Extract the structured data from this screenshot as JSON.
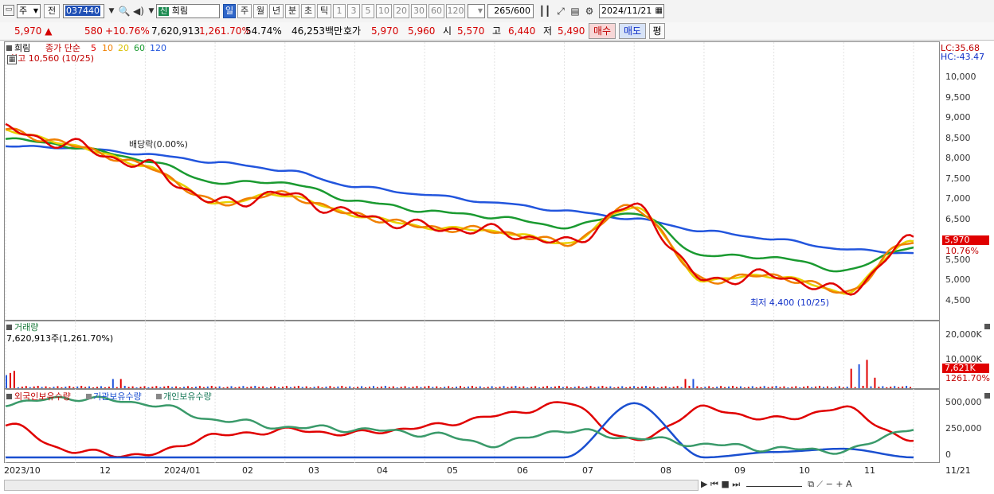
{
  "toolbar": {
    "market_type": "주",
    "prev_label": "전",
    "code": "037440",
    "badge": "신",
    "name": "희림",
    "periods": [
      "일",
      "주",
      "월",
      "년",
      "분",
      "초",
      "틱"
    ],
    "active_period": "일",
    "intervals": [
      "1",
      "3",
      "5",
      "10",
      "20",
      "30",
      "60",
      "120"
    ],
    "count": "265",
    "count_total": "/600",
    "date": "2024/11/21"
  },
  "quote": {
    "price": "5,970",
    "arrow": "▲",
    "change": "580",
    "change_pct": "+10.76%",
    "volume": "7,620,913",
    "volume_pct": "1,261.70%",
    "turnover": "54.74%",
    "amount": "46,253백만",
    "bid_label": "호가",
    "ask": "5,970",
    "bid": "5,960",
    "open_label": "시",
    "open": "5,570",
    "high_label": "고",
    "high": "6,440",
    "low_label": "저",
    "low": "5,490",
    "buy_label": "매수",
    "sell_label": "매도",
    "eval_label": "평"
  },
  "price_pane": {
    "name": "희림",
    "ma_label": "종가 단순",
    "ma_periods": [
      "5",
      "10",
      "20",
      "60",
      "120"
    ],
    "ma_colors": [
      "#e00000",
      "#f08000",
      "#e8d000",
      "#1a9a30",
      "#2255dd"
    ],
    "high_note": "최고 10,560 (10/25)",
    "low_note": "최저 4,400 (10/25)",
    "dividend_note": "배당락(0.00%)",
    "lc": "LC:35.68",
    "hc": "HC:-43.47",
    "y_ticks": [
      "10,000",
      "9,500",
      "9,000",
      "8,500",
      "8,000",
      "7,500",
      "7,000",
      "6,500",
      "6,000",
      "5,500",
      "5,000",
      "4,500"
    ],
    "last_price": "5,970",
    "last_pct": "10.76%"
  },
  "volume_pane": {
    "title": "거래량",
    "value": "7,620,913주(1,261.70%)",
    "y_ticks": [
      "20,000K",
      "10,000K"
    ],
    "tag_value": "7,621K",
    "tag_pct": "1261.70%"
  },
  "holding_pane": {
    "series": [
      "외국인보유수량",
      "기관보유수량",
      "개인보유수량"
    ],
    "y_ticks": [
      "500,000",
      "250,000",
      "0"
    ]
  },
  "x_axis": [
    "2023/10",
    "12",
    "2024/01",
    "02",
    "03",
    "04",
    "05",
    "06",
    "07",
    "08",
    "09",
    "10",
    "11",
    "11/21"
  ],
  "chart_data": [
    {
      "type": "line",
      "name": "price",
      "x": [
        "2023/10",
        "12",
        "2024/01",
        "02",
        "03",
        "04",
        "05",
        "06",
        "07",
        "08",
        "09",
        "10",
        "11",
        "11/21"
      ],
      "series": [
        {
          "name": "5",
          "values": [
            8700,
            8300,
            7800,
            6900,
            7100,
            6600,
            6300,
            6200,
            5900,
            6800,
            5000,
            5100,
            4700,
            5970
          ]
        },
        {
          "name": "120",
          "values": [
            8300,
            8250,
            8100,
            7900,
            7700,
            7300,
            7100,
            6900,
            6700,
            6500,
            6200,
            6000,
            5750,
            5650
          ]
        }
      ],
      "ylim": [
        4300,
        10600
      ]
    },
    {
      "type": "bar",
      "name": "volume",
      "note": "spikes in 2023/10, 08 and 11",
      "ylim": [
        0,
        20000
      ]
    },
    {
      "type": "line",
      "name": "holdings",
      "series": [
        {
          "name": "외국인보유수량",
          "values": [
            300000,
            50000,
            20000,
            200000,
            250000,
            220000,
            280000,
            380000,
            500000,
            150000,
            450000,
            350000,
            450000,
            150000
          ]
        },
        {
          "name": "기관보유수량",
          "values": [
            0,
            0,
            0,
            0,
            0,
            0,
            0,
            0,
            0,
            500000,
            0,
            50000,
            80000,
            0
          ]
        },
        {
          "name": "개인보유수량",
          "values": [
            500000,
            550000,
            500000,
            350000,
            280000,
            260000,
            220000,
            120000,
            250000,
            180000,
            120000,
            80000,
            60000,
            270000
          ]
        }
      ],
      "ylim": [
        0,
        550000
      ]
    }
  ]
}
